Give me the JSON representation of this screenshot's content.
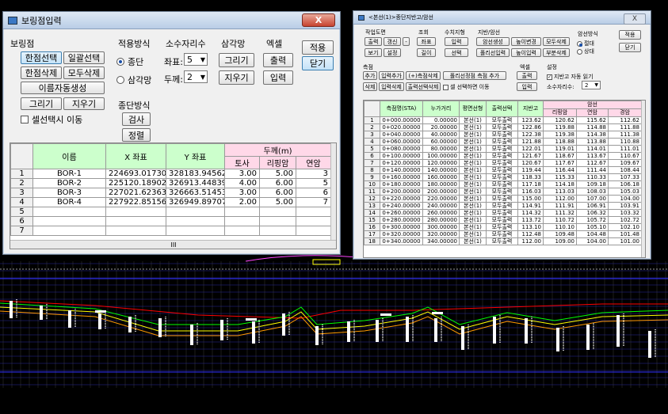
{
  "win1": {
    "title": "보링점입력",
    "close": "X",
    "group_boring": "보링점",
    "btn_single_select": "한점선택",
    "btn_batch_select": "일괄선택",
    "btn_single_delete": "한점삭제",
    "btn_all_delete": "모두삭제",
    "btn_auto_name": "이름자동생성",
    "btn_draw": "그리기",
    "btn_erase": "지우기",
    "chk_select_move": "셀선택시 이동",
    "apply_mode": "적용방식",
    "radio_profile": "종단",
    "radio_triangle": "삼각망",
    "decimals": "소수자리수",
    "coord_label": "좌표:",
    "coord_value": "5",
    "thick_label": "두께:",
    "thick_value": "2",
    "triangle": "삼각망",
    "btn_tri_draw": "그리기",
    "btn_tri_erase": "지우기",
    "excel": "엑셀",
    "btn_output": "출력",
    "btn_input": "입력",
    "btn_apply": "적용",
    "btn_close": "닫기",
    "profile_mode": "종단방식",
    "btn_check": "검사",
    "btn_sort": "정렬",
    "columns": {
      "name": "이름",
      "x": "X 좌표",
      "y": "Y 좌표",
      "thickness": "두께(m)",
      "soil": "토사",
      "weathered": "리핑암",
      "soft": "연암"
    },
    "rows": [
      {
        "no": "1",
        "name": "BOR-1",
        "x": "224693.01730",
        "y": "328183.94562",
        "soil": "3.00",
        "weathered": "5.00",
        "soft": "3"
      },
      {
        "no": "2",
        "name": "BOR-2",
        "x": "225120.18902",
        "y": "326913.44839",
        "soil": "4.00",
        "weathered": "6.00",
        "soft": "5"
      },
      {
        "no": "3",
        "name": "BOR-3",
        "x": "227021.62363",
        "y": "326663.51453",
        "soil": "3.00",
        "weathered": "6.00",
        "soft": "6"
      },
      {
        "no": "4",
        "name": "BOR-4",
        "x": "227922.85156",
        "y": "326949.89707",
        "soil": "2.00",
        "weathered": "5.00",
        "soft": "7"
      },
      {
        "no": "5",
        "name": "",
        "x": "",
        "y": "",
        "soil": "",
        "weathered": "",
        "soft": ""
      },
      {
        "no": "6",
        "name": "",
        "x": "",
        "y": "",
        "soil": "",
        "weathered": "",
        "soft": ""
      },
      {
        "no": "7",
        "name": "",
        "x": "",
        "y": "",
        "soil": "",
        "weathered": "",
        "soft": ""
      }
    ],
    "hscroll_thumb": "III"
  },
  "win2": {
    "title": "<본선(1)>종단지반고/암선",
    "close": "X",
    "work_drawing": "작업도면",
    "btn_out": "출력",
    "btn_renew": "갱신",
    "btn_dash": "-",
    "btn_view": "보기",
    "btn_setting": "설정",
    "query": "조회",
    "btn_coord": "좌표",
    "btn_length": "길이",
    "manual_ground": "수치지형",
    "btn_input": "입력",
    "btn_select": "선택",
    "ground_rock": "지반/암선",
    "btn_rock_gen": "암선생성",
    "btn_height_change": "높이변경",
    "btn_all_delete": "모두삭제",
    "btn_polyline_input": "폴리선입력",
    "btn_height_input": "높이입력",
    "btn_part_delete": "부분삭제",
    "rock_mode": "암선방식",
    "radio_absolute": "절대",
    "radio_relative": "상대",
    "btn_apply": "적용",
    "btn_close": "닫기",
    "measure": "측점",
    "btn_add": "추가",
    "btn_input_add": "입력추가",
    "btn_plus_measure": "(+)측점삭제",
    "btn_polyline_measure": "폴리선정점 측점 추가",
    "btn_delete": "삭제",
    "btn_input_delete": "입력삭제",
    "btn_out_select_delete": "출력선택삭제",
    "chk_move": "셀 선택하면 이동",
    "excel": "엑셀",
    "btn_ex_out": "출력",
    "btn_ex_in": "입력",
    "setting": "설정",
    "chk_auto_read": "지반고 자동 읽기",
    "decimals_label": "소수자리수:",
    "decimals_value": "2",
    "columns": {
      "sta": "측점명(STA)",
      "dist": "누가거리",
      "plan": "평면선형",
      "outline": "출력선택",
      "ground": "지반고",
      "rock": "암선",
      "weathered": "리핑암",
      "soft": "연암",
      "hard": "경암"
    },
    "rows": [
      [
        "1",
        "0+000.00000",
        "0.00000",
        "본선(1)",
        "모두출력",
        "123.62",
        "120.62",
        "115.62",
        "112.62"
      ],
      [
        "2",
        "0+020.00000",
        "20.00000",
        "본선(1)",
        "모두출력",
        "122.86",
        "119.88",
        "114.88",
        "111.88"
      ],
      [
        "3",
        "0+040.00000",
        "40.00000",
        "본선(1)",
        "모두출력",
        "122.38",
        "119.38",
        "114.38",
        "111.38"
      ],
      [
        "4",
        "0+060.00000",
        "60.00000",
        "본선(1)",
        "모두출력",
        "121.88",
        "118.88",
        "113.88",
        "110.88"
      ],
      [
        "5",
        "0+080.00000",
        "80.00000",
        "본선(1)",
        "모두출력",
        "122.01",
        "119.01",
        "114.01",
        "111.01"
      ],
      [
        "6",
        "0+100.00000",
        "100.00000",
        "본선(1)",
        "모두출력",
        "121.67",
        "118.67",
        "113.67",
        "110.67"
      ],
      [
        "7",
        "0+120.00000",
        "120.00000",
        "본선(1)",
        "모두출력",
        "120.67",
        "117.67",
        "112.67",
        "109.67"
      ],
      [
        "8",
        "0+140.00000",
        "140.00000",
        "본선(1)",
        "모두출력",
        "119.44",
        "116.44",
        "111.44",
        "108.44"
      ],
      [
        "9",
        "0+160.00000",
        "160.00000",
        "본선(1)",
        "모두출력",
        "118.33",
        "115.33",
        "110.33",
        "107.33"
      ],
      [
        "10",
        "0+180.00000",
        "180.00000",
        "본선(1)",
        "모두출력",
        "117.18",
        "114.18",
        "109.18",
        "106.18"
      ],
      [
        "11",
        "0+200.00000",
        "200.00000",
        "본선(1)",
        "모두출력",
        "116.03",
        "113.03",
        "108.03",
        "105.03"
      ],
      [
        "12",
        "0+220.00000",
        "220.00000",
        "본선(1)",
        "모두출력",
        "115.00",
        "112.00",
        "107.00",
        "104.00"
      ],
      [
        "13",
        "0+240.00000",
        "240.00000",
        "본선(1)",
        "모두출력",
        "114.91",
        "111.91",
        "106.91",
        "103.91"
      ],
      [
        "14",
        "0+260.00000",
        "260.00000",
        "본선(1)",
        "모두출력",
        "114.32",
        "111.32",
        "106.32",
        "103.32"
      ],
      [
        "15",
        "0+280.00000",
        "280.00000",
        "본선(1)",
        "모두출력",
        "113.72",
        "110.72",
        "105.72",
        "102.72"
      ],
      [
        "16",
        "0+300.00000",
        "300.00000",
        "본선(1)",
        "모두출력",
        "113.10",
        "110.10",
        "105.10",
        "102.10"
      ],
      [
        "17",
        "0+320.00000",
        "320.00000",
        "본선(1)",
        "모두출력",
        "112.48",
        "109.48",
        "104.48",
        "101.48"
      ],
      [
        "18",
        "0+340.00000",
        "340.00000",
        "본선(1)",
        "모두출력",
        "112.00",
        "109.00",
        "104.00",
        "101.00"
      ]
    ]
  },
  "colors": {
    "header_green": "#ccffcc",
    "header_pink": "#ffd8e8",
    "cad_bg": "#000000",
    "ground_line": "#ff0000",
    "rock_line_green": "#00ff00",
    "rock_line_yellow": "#ffff00",
    "rock_line_orange": "#ff9900",
    "grid_blue": "#0000ff"
  }
}
